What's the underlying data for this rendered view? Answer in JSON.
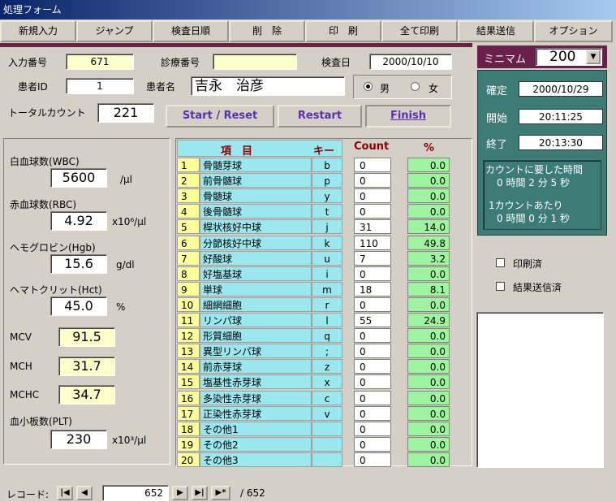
{
  "window": {
    "title": "処理フォーム"
  },
  "menu": [
    "新規入力",
    "ジャンプ",
    "検査日順",
    "削　除",
    "印　刷",
    "全て印刷",
    "結果送信",
    "オプション"
  ],
  "header": {
    "input_no_label": "入力番号",
    "input_no": "671",
    "clinic_no_label": "診療番号",
    "clinic_no": "",
    "exam_date_label": "検査日",
    "exam_date": "2000/10/10",
    "patient_id_label": "患者ID",
    "patient_id": "1",
    "patient_name_label": "患者名",
    "patient_name": "吉永　治彦",
    "sex_male": "男",
    "sex_female": "女",
    "sex_selected": "male",
    "total_count_label": "トータルカウント",
    "total_count": "221"
  },
  "buttons": {
    "start_reset": "Start / Reset",
    "restart": "Restart",
    "finish": "Finish"
  },
  "blood": {
    "wbc_label": "白血球数(WBC)",
    "wbc": "5600",
    "wbc_unit": "/μl",
    "rbc_label": "赤血球数(RBC)",
    "rbc": "4.92",
    "rbc_unit": "x10⁶/μl",
    "hgb_label": "ヘモグロビン(Hgb)",
    "hgb": "15.6",
    "hgb_unit": "g/dl",
    "hct_label": "ヘマトクリット(Hct)",
    "hct": "45.0",
    "hct_unit": "%",
    "mcv_label": "MCV",
    "mcv": "91.5",
    "mch_label": "MCH",
    "mch": "31.7",
    "mchc_label": "MCHC",
    "mchc": "34.7",
    "plt_label": "血小板数(PLT)",
    "plt": "230",
    "plt_unit": "x10³/μl"
  },
  "table": {
    "col_item": "項　目",
    "col_key": "キー",
    "col_count": "Count",
    "col_pct": "%",
    "rows": [
      {
        "no": "1",
        "name": "骨髄芽球",
        "key": "b",
        "count": "0",
        "pct": "0.0"
      },
      {
        "no": "2",
        "name": "前骨髄球",
        "key": "p",
        "count": "0",
        "pct": "0.0"
      },
      {
        "no": "3",
        "name": "骨髄球",
        "key": "y",
        "count": "0",
        "pct": "0.0"
      },
      {
        "no": "4",
        "name": "後骨髄球",
        "key": "t",
        "count": "0",
        "pct": "0.0"
      },
      {
        "no": "5",
        "name": "桿状核好中球",
        "key": "j",
        "count": "31",
        "pct": "14.0"
      },
      {
        "no": "6",
        "name": "分節核好中球",
        "key": "k",
        "count": "110",
        "pct": "49.8"
      },
      {
        "no": "7",
        "name": "好酸球",
        "key": "u",
        "count": "7",
        "pct": "3.2"
      },
      {
        "no": "8",
        "name": "好塩基球",
        "key": "i",
        "count": "0",
        "pct": "0.0"
      },
      {
        "no": "9",
        "name": "単球",
        "key": "m",
        "count": "18",
        "pct": "8.1"
      },
      {
        "no": "10",
        "name": "細網細胞",
        "key": "r",
        "count": "0",
        "pct": "0.0"
      },
      {
        "no": "11",
        "name": "リンパ球",
        "key": "l",
        "count": "55",
        "pct": "24.9"
      },
      {
        "no": "12",
        "name": "形質細胞",
        "key": "q",
        "count": "0",
        "pct": "0.0"
      },
      {
        "no": "13",
        "name": "異型リンパ球",
        "key": ";",
        "count": "0",
        "pct": "0.0"
      },
      {
        "no": "14",
        "name": "前赤芽球",
        "key": "z",
        "count": "0",
        "pct": "0.0"
      },
      {
        "no": "15",
        "name": "塩基性赤芽球",
        "key": "x",
        "count": "0",
        "pct": "0.0"
      },
      {
        "no": "16",
        "name": "多染性赤芽球",
        "key": "c",
        "count": "0",
        "pct": "0.0"
      },
      {
        "no": "17",
        "name": "正染性赤芽球",
        "key": "v",
        "count": "0",
        "pct": "0.0"
      },
      {
        "no": "18",
        "name": "その他1",
        "key": "",
        "count": "0",
        "pct": "0.0"
      },
      {
        "no": "19",
        "name": "その他2",
        "key": "",
        "count": "0",
        "pct": "0.0"
      },
      {
        "no": "20",
        "name": "その他3",
        "key": "",
        "count": "0",
        "pct": "0.0"
      }
    ]
  },
  "right": {
    "minimum_label": "ミニマム",
    "minimum_value": "200",
    "confirm_label": "確定",
    "confirm_date": "2000/10/29",
    "start_label": "開始",
    "start_time": "20:11:25",
    "end_label": "終了",
    "end_time": "20:13:30",
    "elapsed_title": "カウントに要した時間",
    "elapsed_value": "0 時間 2 分 5 秒",
    "per_count_title": "1カウントあたり",
    "per_count_value": "0 時間 0 分 1 秒",
    "printed_label": "印刷済",
    "sent_label": "結果送信済"
  },
  "nav": {
    "record_label": "レコード:",
    "current": "652",
    "total": "/ 652"
  },
  "colors": {
    "accent": "#6b2049",
    "teal": "#3d7b77",
    "key_cyan": "#9ae7f0",
    "pct_green": "#9ff59f",
    "num_yellow": "#ffff99"
  }
}
